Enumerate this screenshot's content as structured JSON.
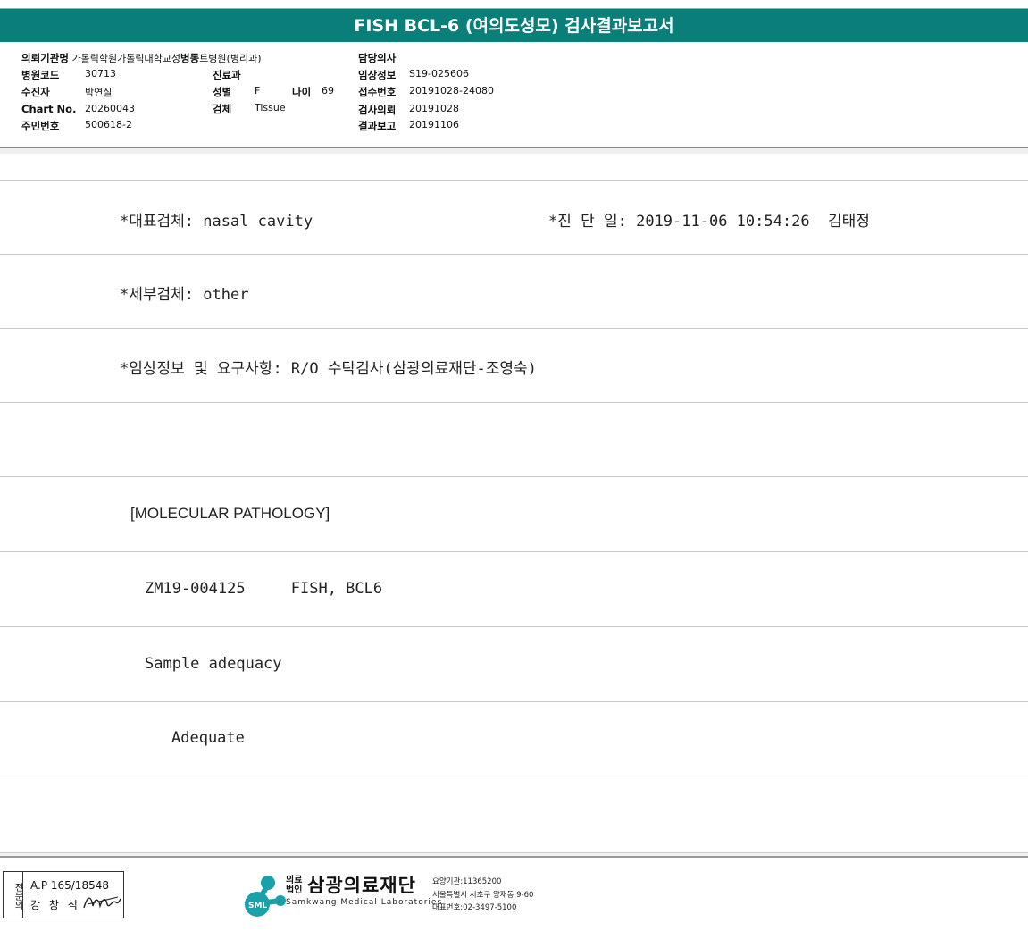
{
  "title": "FISH BCL-6 (여의도성모) 검사결과보고서",
  "header": {
    "institution_label": "의뢰기관명",
    "institution_value": "가톨릭학원가톨릭대학교성",
    "ward_label": "병동",
    "ward_value": "트병원(병리과)",
    "hospital_code_label": "병원코드",
    "hospital_code_value": "30713",
    "patient_label": "수진자",
    "patient_value": "박연실",
    "chart_label": "Chart No.",
    "chart_value": "20260043",
    "resident_label": "주민번호",
    "resident_value": "500618-2",
    "dept_label": "진료과",
    "dept_value": "",
    "sex_label": "성별",
    "sex_value": "F",
    "age_label": "나이",
    "age_value": "69",
    "specimen_label": "검체",
    "specimen_value": "Tissue",
    "doctor_label": "담당의사",
    "doctor_value": "",
    "clinical_label": "임상정보",
    "clinical_value": "S19-025606",
    "receipt_label": "접수번호",
    "receipt_value": "20191028-24080",
    "request_label": "검사의뢰",
    "request_value": "20191028",
    "report_label": "결과보고",
    "report_value": "20191106"
  },
  "report": {
    "rep_specimen": "*대표검체: nasal cavity",
    "diag_date": "*진 단 일: 2019-11-06 10:54:26  김태정",
    "sub_specimen": "*세부검체: other",
    "clinical_info": "*임상정보 및 요구사항: R/O 수탁검사(삼광의료재단-조영숙)",
    "section": "[MOLECULAR PATHOLOGY]",
    "test_line": "ZM19-004125     FISH, BCL6",
    "sample_heading": "Sample adequacy",
    "sample_result": "Adequate"
  },
  "footer": {
    "stamp_side": "전문의",
    "stamp_line1": "A.P 165/18548",
    "stamp_line2": "강 창 석",
    "logo_small": "의료\n법인",
    "logo_name": "삼광의료재단",
    "logo_en": "Samkwang Medical Laboratories",
    "logo_badge": "SML",
    "info1": "요양기관:11365200",
    "info2": "서울특별시 서초구 양재동 9-60",
    "info3": "대표번호:02-3497-5100"
  }
}
